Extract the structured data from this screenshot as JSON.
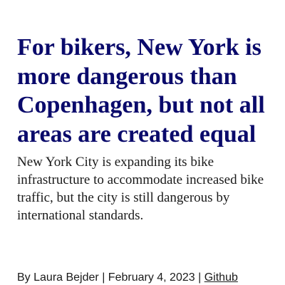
{
  "article": {
    "headline": "For bikers, New York is more dangerous than Copenhagen, but not all areas are created equal",
    "dek": "New York City is expanding its bike infrastructure to accommodate increased bike traffic, but the city is still dangerous by international standards.",
    "byline": {
      "author": "By Laura Bejder",
      "separator": "|",
      "date": "February 4, 2023",
      "link_label": "Github"
    }
  },
  "colors": {
    "headline": "#0a0a6b",
    "body_text": "#1a1a1a",
    "background": "#ffffff"
  }
}
